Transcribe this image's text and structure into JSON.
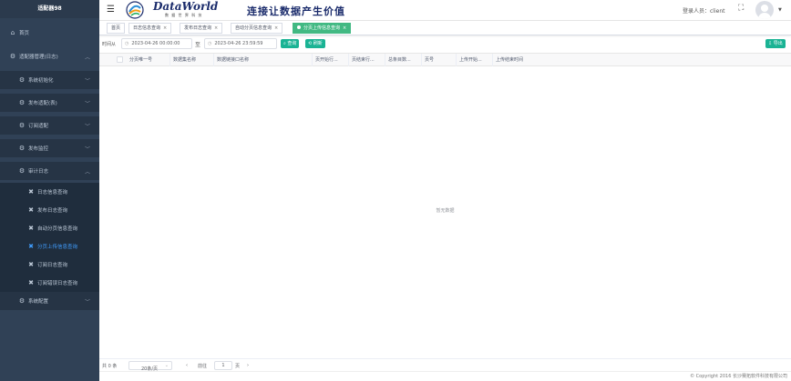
{
  "sidebar": {
    "title": "适配器98",
    "items": [
      {
        "label": "首页",
        "icon": "home-icon",
        "glyph": "⌂"
      },
      {
        "label": "适配器管理(日志)",
        "icon": "gear-icon",
        "glyph": "⚙",
        "arrow": "︿"
      },
      {
        "label": "系统初始化",
        "icon": "gear-icon",
        "glyph": "⚙",
        "arrow": "﹀"
      },
      {
        "label": "发布适配(表)",
        "icon": "gear-icon",
        "glyph": "⚙",
        "arrow": "﹀"
      },
      {
        "label": "订阅适配",
        "icon": "gear-icon",
        "glyph": "⚙",
        "arrow": "﹀"
      },
      {
        "label": "发布监控",
        "icon": "gear-icon",
        "glyph": "⚙",
        "arrow": "﹀"
      },
      {
        "label": "审计日志",
        "icon": "gear-icon",
        "glyph": "⚙",
        "arrow": "︿"
      },
      {
        "label": "日志信息查询",
        "icon": "tools-icon",
        "glyph": "✖"
      },
      {
        "label": "发布日志查询",
        "icon": "tools-icon",
        "glyph": "✖"
      },
      {
        "label": "自动分页信息查询",
        "icon": "tools-icon",
        "glyph": "✖"
      },
      {
        "label": "分页上传信息查询",
        "icon": "tools-icon",
        "glyph": "✖"
      },
      {
        "label": "订阅日志查询",
        "icon": "tools-icon",
        "glyph": "✖"
      },
      {
        "label": "订阅错误日志查询",
        "icon": "tools-icon",
        "glyph": "✖"
      },
      {
        "label": "系统配置",
        "icon": "gear-icon",
        "glyph": "⚙",
        "arrow": "﹀"
      }
    ]
  },
  "header": {
    "menu_glyph": "☰",
    "brand": "DataWorld",
    "brand_sub": "数 据 世 界 科 技",
    "slogan": "连接让数据产生价值",
    "login_label": "登录人员：client",
    "fullscreen_glyph": "⛶",
    "caret_glyph": "▼"
  },
  "tags": [
    {
      "label": "首页"
    },
    {
      "label": "日志信息查询",
      "close": "×"
    },
    {
      "label": "发布日志查询",
      "close": "×"
    },
    {
      "label": "自动分页信息查询",
      "close": "×"
    },
    {
      "label": "分页上传信息查询",
      "close": "×",
      "active": true
    }
  ],
  "filter": {
    "time_label": "时间从",
    "start_date": "2023-04-26 00:00:00",
    "separator": "至",
    "end_date": "2023-04-26 23:59:59",
    "clock_glyph": "◷",
    "query_label": "⌕ 查询",
    "reset_label": "⟲ 刷新",
    "export_label": "⇩ 导出"
  },
  "table": {
    "columns": [
      "分页唯一号",
      "数据集名称",
      "数据链接口名称",
      "页开始行...",
      "页结束行...",
      "总条目数...",
      "页号",
      "上传开始...",
      "上传结束时间"
    ],
    "empty_text": "暂无数据"
  },
  "pager": {
    "total": "共 0 条",
    "page_size": "20条/页",
    "prev": "‹",
    "next": "›",
    "goto_label": "前往",
    "current_page": "1",
    "page_unit": "页",
    "dropdown_glyph": "⌄"
  },
  "footer": {
    "copyright": "© Copyright 2016 长沙赛拓软件科技有限公司"
  }
}
